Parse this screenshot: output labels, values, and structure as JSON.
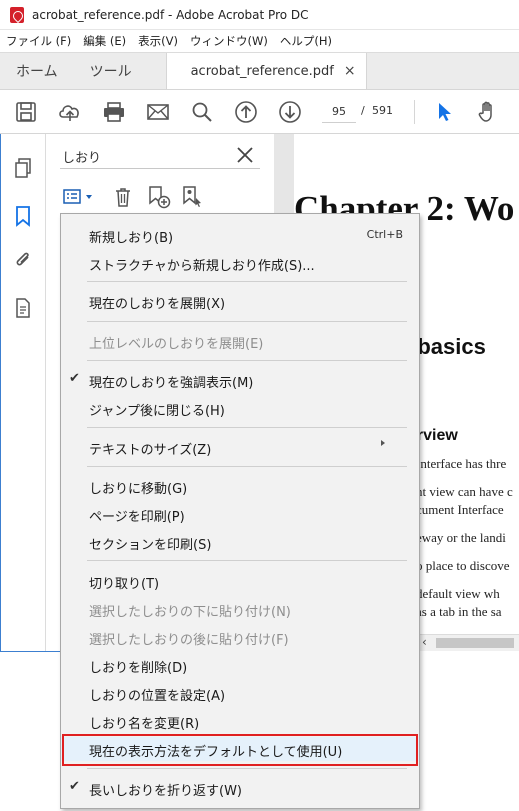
{
  "window": {
    "title": "acrobat_reference.pdf - Adobe Acrobat Pro DC"
  },
  "menubar": [
    "ファイル (F)",
    "編集 (E)",
    "表示(V)",
    "ウィンドウ(W)",
    "ヘルプ(H)"
  ],
  "tabs": {
    "home": "ホーム",
    "tools": "ツール",
    "document": "acrobat_reference.pdf",
    "close": "×"
  },
  "toolbar": {
    "page_current": "95",
    "page_sep": "/",
    "page_total": "591"
  },
  "bookmark_panel": {
    "title": "しおり"
  },
  "document": {
    "heading1": "Chapter 2: Wo",
    "heading2": "e basics",
    "heading3": "erview",
    "lines": [
      "Interface has thre",
      "nt view can have c",
      "cument Interface",
      "eway or the landi",
      "o place to discove",
      "default view wh",
      "as a tab in the sa"
    ]
  },
  "context_menu": {
    "items": [
      {
        "label": "新規しおり(B)",
        "shortcut": "Ctrl+B",
        "disabled": false,
        "checked": false
      },
      {
        "label": "ストラクチャから新規しおり作成(S)...",
        "disabled": false,
        "checked": false
      },
      {
        "label": "現在のしおりを展開(X)",
        "disabled": false,
        "checked": false
      },
      {
        "label": "上位レベルのしおりを展開(E)",
        "disabled": true,
        "checked": false
      },
      {
        "label": "現在のしおりを強調表示(M)",
        "disabled": false,
        "checked": true
      },
      {
        "label": "ジャンプ後に閉じる(H)",
        "disabled": false,
        "checked": false
      },
      {
        "label": "テキストのサイズ(Z)",
        "disabled": false,
        "checked": false,
        "submenu": true
      },
      {
        "label": "しおりに移動(G)",
        "disabled": false,
        "checked": false
      },
      {
        "label": "ページを印刷(P)",
        "disabled": false,
        "checked": false
      },
      {
        "label": "セクションを印刷(S)",
        "disabled": false,
        "checked": false
      },
      {
        "label": "切り取り(T)",
        "disabled": false,
        "checked": false
      },
      {
        "label": "選択したしおりの下に貼り付け(N)",
        "disabled": true,
        "checked": false
      },
      {
        "label": "選択したしおりの後に貼り付け(F)",
        "disabled": true,
        "checked": false
      },
      {
        "label": "しおりを削除(D)",
        "disabled": false,
        "checked": false
      },
      {
        "label": "しおりの位置を設定(A)",
        "disabled": false,
        "checked": false
      },
      {
        "label": "しおり名を変更(R)",
        "disabled": false,
        "checked": false
      },
      {
        "label": "現在の表示方法をデフォルトとして使用(U)",
        "disabled": false,
        "checked": false,
        "highlighted": true
      },
      {
        "label": "長いしおりを折り返す(W)",
        "disabled": false,
        "checked": true
      }
    ]
  },
  "colors": {
    "accent": "#1473e6",
    "highlight_border": "#e02020",
    "menu_bg": "#f2f2f2"
  }
}
